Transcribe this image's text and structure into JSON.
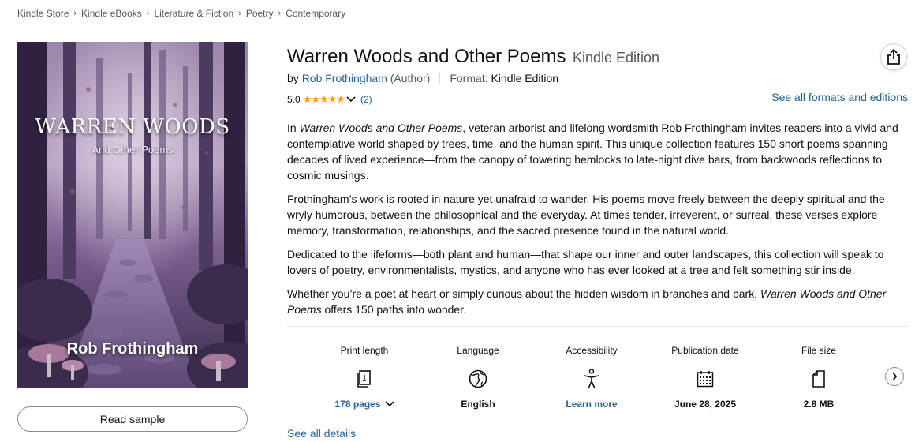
{
  "breadcrumb": [
    "Kindle Store",
    "Kindle eBooks",
    "Literature & Fiction",
    "Poetry",
    "Contemporary"
  ],
  "cover": {
    "title": "WARREN WOODS",
    "subtitle": "And Other Poems",
    "author": "Rob Frothingham"
  },
  "read_sample_label": "Read sample",
  "product": {
    "title": "Warren Woods and Other Poems",
    "edition": "Kindle Edition",
    "by_label": "by",
    "author": "Rob Frothingham",
    "author_role": "(Author)",
    "format_label": "Format:",
    "format_value": "Kindle Edition",
    "rating": "5.0",
    "stars": "★★★★★",
    "rating_count": "(2)",
    "see_all_formats": "See all formats and editions"
  },
  "description": {
    "p1": {
      "pre": "In ",
      "italic": "Warren Woods and Other Poems",
      "post": ", veteran arborist and lifelong wordsmith Rob Frothingham invites readers into a vivid and contemplative world shaped by trees, time, and the human spirit. This unique collection features 150 short poems spanning decades of lived experience—from the canopy of towering hemlocks to late-night dive bars, from backwoods reflections to cosmic musings."
    },
    "p2": "Frothingham’s work is rooted in nature yet unafraid to wander. His poems move freely between the deeply spiritual and the wryly humorous, between the philosophical and the everyday. At times tender, irreverent, or surreal, these verses explore memory, transformation, relationships, and the sacred presence found in the natural world.",
    "p3": "Dedicated to the lifeforms—both plant and human—that shape our inner and outer landscapes, this collection will speak to lovers of poetry, environmentalists, mystics, and anyone who has ever looked at a tree and felt something stir inside.",
    "p4": {
      "pre": "Whether you’re a poet at heart or simply curious about the hidden wisdom in branches and bark, ",
      "italic": "Warren Woods and Other Poems",
      "post": " offers 150 paths into wonder."
    }
  },
  "details": [
    {
      "label": "Print length",
      "icon": "book-pages-icon",
      "value": "178 pages"
    },
    {
      "label": "Language",
      "icon": "globe-icon",
      "value": "English"
    },
    {
      "label": "Accessibility",
      "icon": "accessibility-person-icon",
      "value": "Learn more"
    },
    {
      "label": "Publication date",
      "icon": "calendar-icon",
      "value": "June 28, 2025"
    },
    {
      "label": "File size",
      "icon": "file-icon",
      "value": "2.8 MB"
    }
  ],
  "see_all_details": "See all details",
  "colors": {
    "link": "#2162a1",
    "star": "#ff9900",
    "text": "#0f1111",
    "muted": "#565959",
    "cover_purple": "#6b4f86"
  }
}
